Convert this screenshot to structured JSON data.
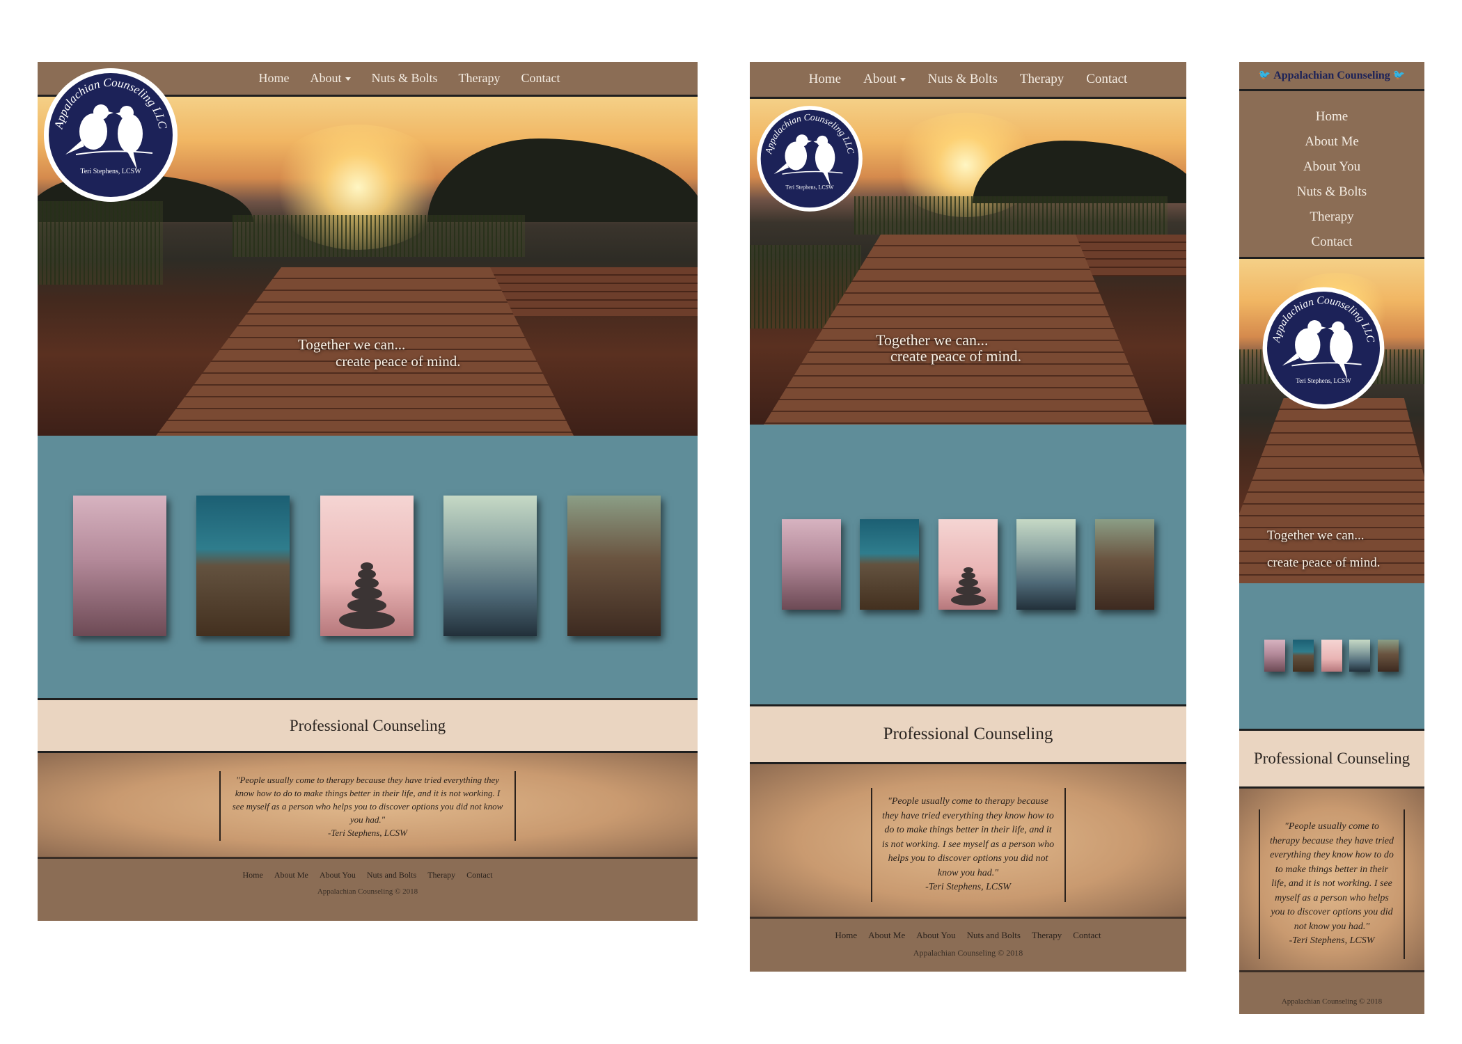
{
  "brand": {
    "name": "Appalachian Counseling",
    "logo_arc": "Appalachian Counseling LLC",
    "logo_sub": "Teri Stephens, LCSW"
  },
  "nav": {
    "home": "Home",
    "about": "About",
    "nuts": "Nuts & Bolts",
    "therapy": "Therapy",
    "contact": "Contact"
  },
  "mobile_menu": [
    "Home",
    "About Me",
    "About You",
    "Nuts & Bolts",
    "Therapy",
    "Contact"
  ],
  "hero": {
    "line1": "Together we can...",
    "line2": "create peace of mind."
  },
  "gallery": {
    "images": [
      "reeds-photo",
      "dock-water-photo",
      "stacked-stones-photo",
      "mother-child-lake-photo",
      "forest-horse-photo"
    ]
  },
  "section_title": "Professional Counseling",
  "quote": {
    "text": "\"People usually come to therapy because they have tried everything they know how to do to make things better in their life, and it is not working. I see myself as a person who helps you to discover options you did not know you had.\"",
    "author": "-Teri Stephens, LCSW"
  },
  "footer": {
    "links": [
      "Home",
      "About Me",
      "About You",
      "Nuts and Bolts",
      "Therapy",
      "Contact"
    ],
    "copyright": "Appalachian Counseling © 2018"
  },
  "colors": {
    "nav_brown": "#8b6d55",
    "teal": "#5f8d99",
    "cream": "#ead5c1",
    "logo_navy": "#1c2258"
  }
}
